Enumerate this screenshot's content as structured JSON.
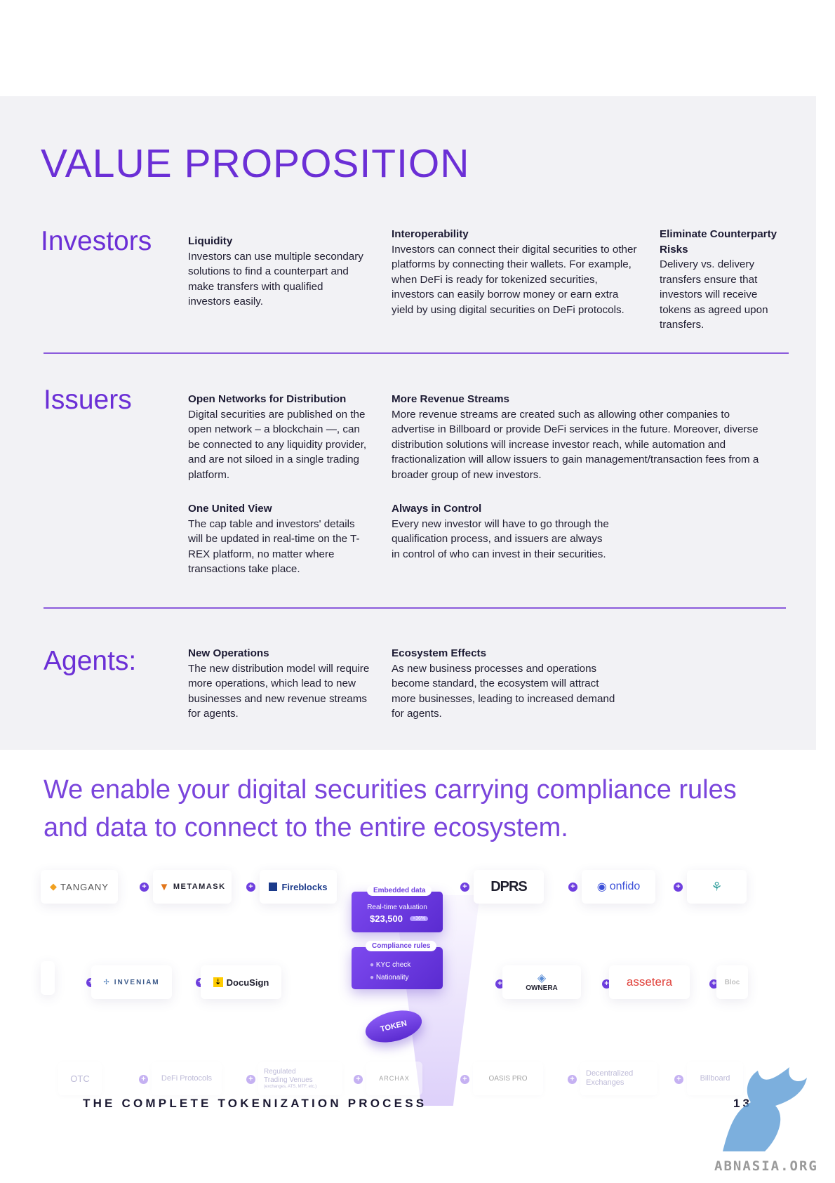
{
  "title": "VALUE PROPOSITION",
  "sections": [
    {
      "label": "Investors",
      "blocks": [
        {
          "heading": "Liquidity",
          "body": "Investors can use multiple secondary solutions to find a counterpart and make transfers with qualified investors easily."
        },
        {
          "heading": "Interoperability",
          "body": "Investors can connect their digital securities to other platforms by connecting their wallets. For example, when DeFi is ready for tokenized securities, investors can easily borrow money or earn extra yield by using digital securities on DeFi protocols."
        },
        {
          "heading": "Eliminate Counterparty Risks",
          "body": "Delivery vs. delivery transfers ensure that investors will receive tokens as agreed upon transfers."
        }
      ]
    },
    {
      "label": "Issuers",
      "blocks": [
        {
          "heading": "Open Networks for Distribution",
          "body": "Digital securities are published on the open network – a blockchain —, can be connected to any liquidity provider, and are not siloed in a single trading platform."
        },
        {
          "heading": "More Revenue Streams",
          "body": "More revenue streams are created such as allowing other companies to advertise in Billboard or provide DeFi services in the future. Moreover, diverse distribution solutions will increase investor reach, while automation and fractionalization will allow issuers to gain management/transaction fees from a broader group of new investors."
        },
        {
          "heading": "One United View",
          "body": "The cap table and investors' details will be updated in real-time on the T-REX platform, no matter where transactions take place."
        },
        {
          "heading": "Always in Control",
          "body": "Every new investor will have to go through the qualification process, and issuers are always in control of who can invest in their securities."
        }
      ]
    },
    {
      "label": "Agents:",
      "blocks": [
        {
          "heading": "New Operations",
          "body": "The new distribution model will require more operations, which lead to new businesses and new revenue streams for agents."
        },
        {
          "heading": "Ecosystem Effects",
          "body": "As new business processes and operations become standard, the ecosystem will attract more businesses, leading to increased demand for agents."
        }
      ]
    }
  ],
  "tagline": "We enable your digital securities carrying compliance rules and data to connect to the entire ecosystem.",
  "ecosystem": {
    "row1": [
      "TANGANY",
      "METAMASK",
      "Fireblocks",
      "DPRS",
      "onfido"
    ],
    "row2": [
      "INVENIAM",
      "DocuSign",
      "OWNERA",
      "assetera",
      "Bloc"
    ],
    "row3": [
      "OTC",
      "DeFi Protocols",
      "Regulated Trading Venues",
      "ARCHAX",
      "OASIS PRO",
      "Decentralized Exchanges",
      "Billboard"
    ],
    "row3_sub": "(exchanges, ATS, MTF, etc.)",
    "embedded_label": "Embedded data",
    "valuation_label": "Real-time valuation",
    "valuation_value": "$23,500",
    "valuation_change": "+36%",
    "compliance_label": "Compliance rules",
    "compliance_items": [
      "KYC check",
      "Nationality"
    ],
    "token_label": "TOKEN"
  },
  "footer": {
    "doc_title": "THE COMPLETE TOKENIZATION PROCESS",
    "page_number": "13",
    "watermark": "ABNASIA.ORG"
  },
  "colors": {
    "accent": "#6b2fd6",
    "panel_bg": "#f2f2f5",
    "text": "#1c1a33"
  }
}
